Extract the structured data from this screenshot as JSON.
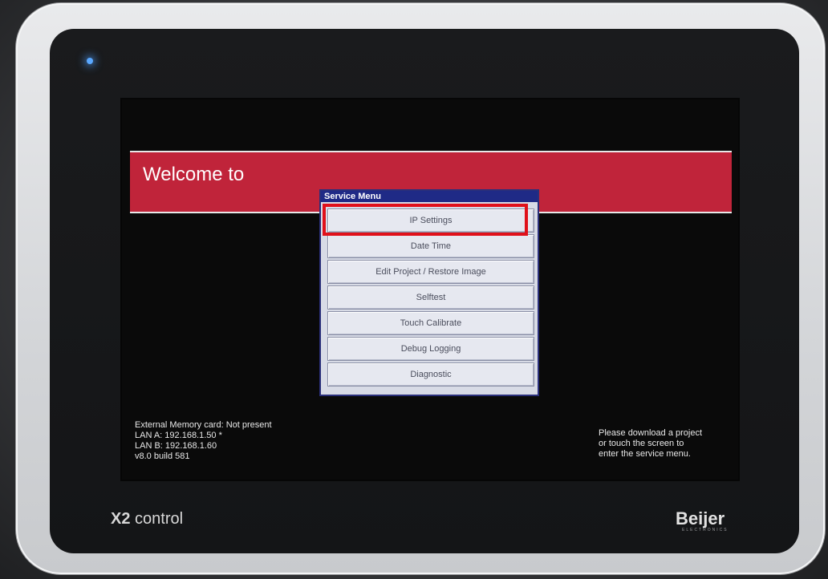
{
  "screen": {
    "welcome": "Welcome to"
  },
  "service_menu": {
    "title": "Service Menu",
    "items": [
      "IP Settings",
      "Date Time",
      "Edit Project / Restore Image",
      "Selftest",
      "Touch Calibrate",
      "Debug Logging",
      "Diagnostic"
    ]
  },
  "status": {
    "external_memory": "External Memory card: Not present",
    "lan_a": "LAN A: 192.168.1.50 *",
    "lan_b": "LAN B: 192.168.1.60",
    "version": "v8.0 build 581"
  },
  "prompt": {
    "line1": "Please download a project",
    "line2": "or touch the screen to",
    "line3": "enter the service menu."
  },
  "device": {
    "model_bold": "X2",
    "model_rest": "control",
    "brand": "Beijer",
    "brand_sub": "ELECTRONICS"
  },
  "colors": {
    "welcome_bar": "#c0243a",
    "menu_title_bar": "#1f2a86",
    "highlight": "#e0101a"
  }
}
